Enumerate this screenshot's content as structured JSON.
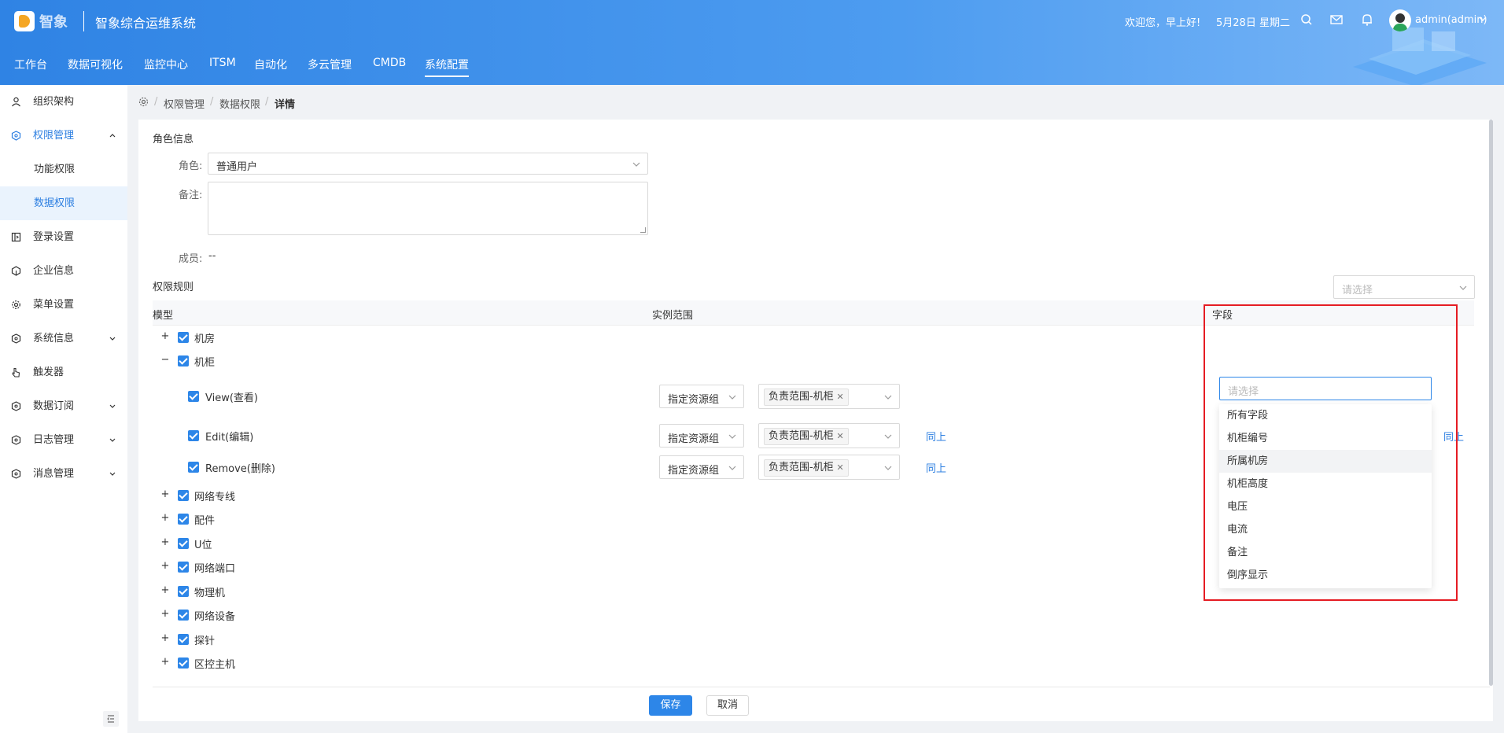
{
  "header": {
    "logo_text": "智象",
    "app_title": "智象综合运维系统",
    "greeting": "欢迎您，早上好!",
    "date": "5月28日 星期二",
    "user": "admin(admin)",
    "icons": [
      "search-icon",
      "mail-icon",
      "bell-icon",
      "avatar",
      "chevron-down-icon"
    ]
  },
  "nav": {
    "items": [
      "工作台",
      "数据可视化",
      "监控中心",
      "ITSM",
      "自动化",
      "多云管理",
      "CMDB",
      "系统配置"
    ],
    "active": "系统配置"
  },
  "sidebar": {
    "items": [
      {
        "label": "组织架构",
        "icon": "user-icon"
      },
      {
        "label": "权限管理",
        "icon": "shield-icon",
        "expanded": true
      },
      {
        "label": "功能权限"
      },
      {
        "label": "数据权限",
        "selected": true
      },
      {
        "label": "登录设置",
        "icon": "login-icon"
      },
      {
        "label": "企业信息",
        "icon": "building-icon"
      },
      {
        "label": "菜单设置",
        "icon": "gear-icon"
      },
      {
        "label": "系统信息",
        "icon": "cube-icon"
      },
      {
        "label": "触发器",
        "icon": "pointer-icon"
      },
      {
        "label": "数据订阅",
        "icon": "cube-icon"
      },
      {
        "label": "日志管理",
        "icon": "cube-icon"
      },
      {
        "label": "消息管理",
        "icon": "cube-icon"
      }
    ]
  },
  "breadcrumb": {
    "items": [
      "权限管理",
      "数据权限",
      "详情"
    ]
  },
  "role_info": {
    "title": "角色信息",
    "role_label": "角色:",
    "role_value": "普通用户",
    "remark_label": "备注:",
    "members_label": "成员:",
    "members_value": "--"
  },
  "rules": {
    "title": "权限规则",
    "filter_placeholder": "请选择",
    "columns": [
      "模型",
      "实例范围",
      "字段"
    ],
    "tree": [
      {
        "label": "机房",
        "expanded": false
      },
      {
        "label": "机柜",
        "expanded": true,
        "children": [
          {
            "label": "View(查看)",
            "scope": "指定资源组",
            "tag": "负责范围-机柜",
            "same_above": ""
          },
          {
            "label": "Edit(编辑)",
            "scope": "指定资源组",
            "tag": "负责范围-机柜",
            "same_above": "同上"
          },
          {
            "label": "Remove(删除)",
            "scope": "指定资源组",
            "tag": "负责范围-机柜",
            "same_above": "同上"
          }
        ]
      },
      {
        "label": "网络专线",
        "expanded": false
      },
      {
        "label": "配件",
        "expanded": false
      },
      {
        "label": "U位",
        "expanded": false
      },
      {
        "label": "网络端口",
        "expanded": false
      },
      {
        "label": "物理机",
        "expanded": false
      },
      {
        "label": "网络设备",
        "expanded": false
      },
      {
        "label": "探针",
        "expanded": false
      },
      {
        "label": "区控主机",
        "expanded": false
      }
    ],
    "edit_same_above_right": "同上"
  },
  "field_dropdown": {
    "placeholder": "请选择",
    "options": [
      "所有字段",
      "机柜编号",
      "所属机房",
      "机柜高度",
      "电压",
      "电流",
      "备注",
      "倒序显示"
    ],
    "hovered": "所属机房"
  },
  "buttons": {
    "save": "保存",
    "cancel": "取消"
  },
  "colors": {
    "primary": "#2d86e8",
    "header_gradient_start": "#2f83e4",
    "highlight_border": "#e51c23"
  }
}
